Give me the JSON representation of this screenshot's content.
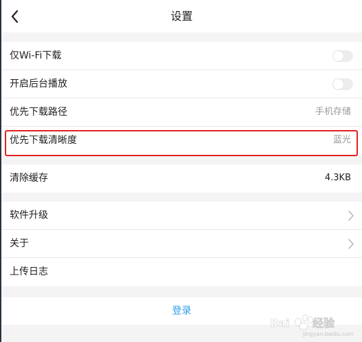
{
  "header": {
    "title": "设置"
  },
  "settings": {
    "group1": [
      {
        "label": "仅Wi-Fi下载",
        "type": "toggle",
        "enabled": false
      },
      {
        "label": "开启后台播放",
        "type": "toggle",
        "enabled": false
      },
      {
        "label": "优先下载路径",
        "type": "value",
        "value": "手机存储"
      },
      {
        "label": "优先下载清晰度",
        "type": "value",
        "value": "蓝光"
      }
    ],
    "group2": [
      {
        "label": "清除缓存",
        "type": "value",
        "value": "4.3KB"
      }
    ],
    "group3": [
      {
        "label": "软件升级",
        "type": "chevron"
      },
      {
        "label": "关于",
        "type": "chevron"
      },
      {
        "label": "上传日志",
        "type": "plain"
      }
    ]
  },
  "login": {
    "label": "登录"
  },
  "watermark": {
    "text": "Baidu经验",
    "sub": "jingyan.baidu.com"
  },
  "colors": {
    "accent": "#2f9ce8",
    "highlight": "#e02020",
    "background": "#f4f4f5"
  },
  "icons": {
    "back": "chevron-left-icon",
    "chevron": "chevron-right-icon"
  }
}
